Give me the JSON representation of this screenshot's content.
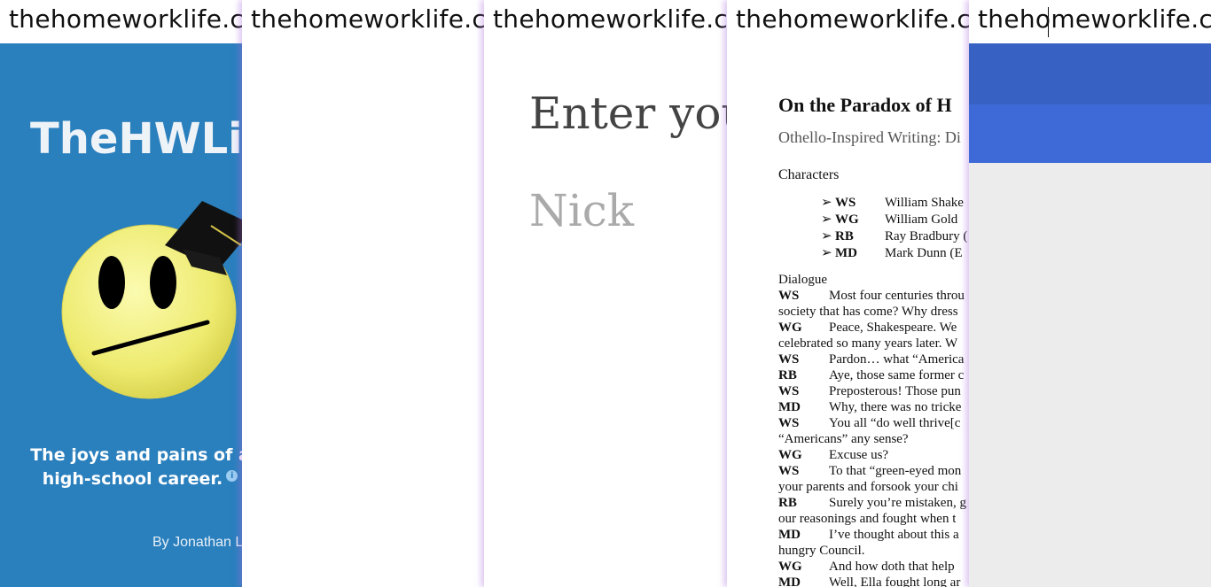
{
  "panels": [
    {
      "url": "thehomeworklife.com",
      "site_title": "TheHWLife",
      "tagline_line1": "The joys and pains of a",
      "tagline_line2": "high-school career.",
      "byline": "By Jonathan L",
      "info_glyph": "i"
    },
    {
      "url": "thehomeworklife.com"
    },
    {
      "url": "thehomeworklife.com",
      "heading": "Enter your",
      "name_value": "Nick"
    },
    {
      "url": "thehomeworklife.com",
      "doc_title": "On the Paradox of H",
      "doc_subtitle": "Othello-Inspired Writing: Di",
      "characters_heading": "Characters",
      "characters": [
        {
          "abbr": "WS",
          "name": "William Shake"
        },
        {
          "abbr": "WG",
          "name": "William Gold"
        },
        {
          "abbr": "RB",
          "name": "Ray Bradbury ("
        },
        {
          "abbr": "MD",
          "name": "Mark Dunn (E"
        }
      ],
      "dialogue_heading": "Dialogue",
      "dialogue": [
        {
          "speaker": "WS",
          "text": "Most four centuries throu"
        },
        {
          "speaker": "",
          "text": "society that has come? Why dress"
        },
        {
          "speaker": "WG",
          "text": "Peace, Shakespeare. We"
        },
        {
          "speaker": "",
          "text": "celebrated so many years later. W"
        },
        {
          "speaker": "WS",
          "text": "Pardon… what “America"
        },
        {
          "speaker": "RB",
          "text": "Aye, those same former c"
        },
        {
          "speaker": "WS",
          "text": "Preposterous! Those pun"
        },
        {
          "speaker": "MD",
          "text": "Why, there was no tricke"
        },
        {
          "speaker": "WS",
          "text": "You all “do well thrive[c"
        },
        {
          "speaker": "",
          "text": "“Americans” any sense?"
        },
        {
          "speaker": "WG",
          "text": "Excuse us?"
        },
        {
          "speaker": "WS",
          "text": "To that “green-eyed mon"
        },
        {
          "speaker": "",
          "text": "your parents and forsook your chi"
        },
        {
          "speaker": "RB",
          "text": "Surely you’re mistaken, g"
        },
        {
          "speaker": "",
          "text": "our reasonings and fought when t"
        },
        {
          "speaker": "MD",
          "text": "I’ve thought about this a"
        },
        {
          "speaker": "",
          "text": "hungry Council."
        },
        {
          "speaker": "WG",
          "text": "And how doth that help"
        },
        {
          "speaker": "MD",
          "text": "Well, Ella fought long ar"
        }
      ]
    },
    {
      "url": "thehomeworklife.com"
    }
  ],
  "colors": {
    "panel1_bg": "#2a7fbd",
    "panel5_band_dark": "#3761c2",
    "panel5_band_light": "#3d6ad7",
    "panel5_bg": "#ececec"
  }
}
